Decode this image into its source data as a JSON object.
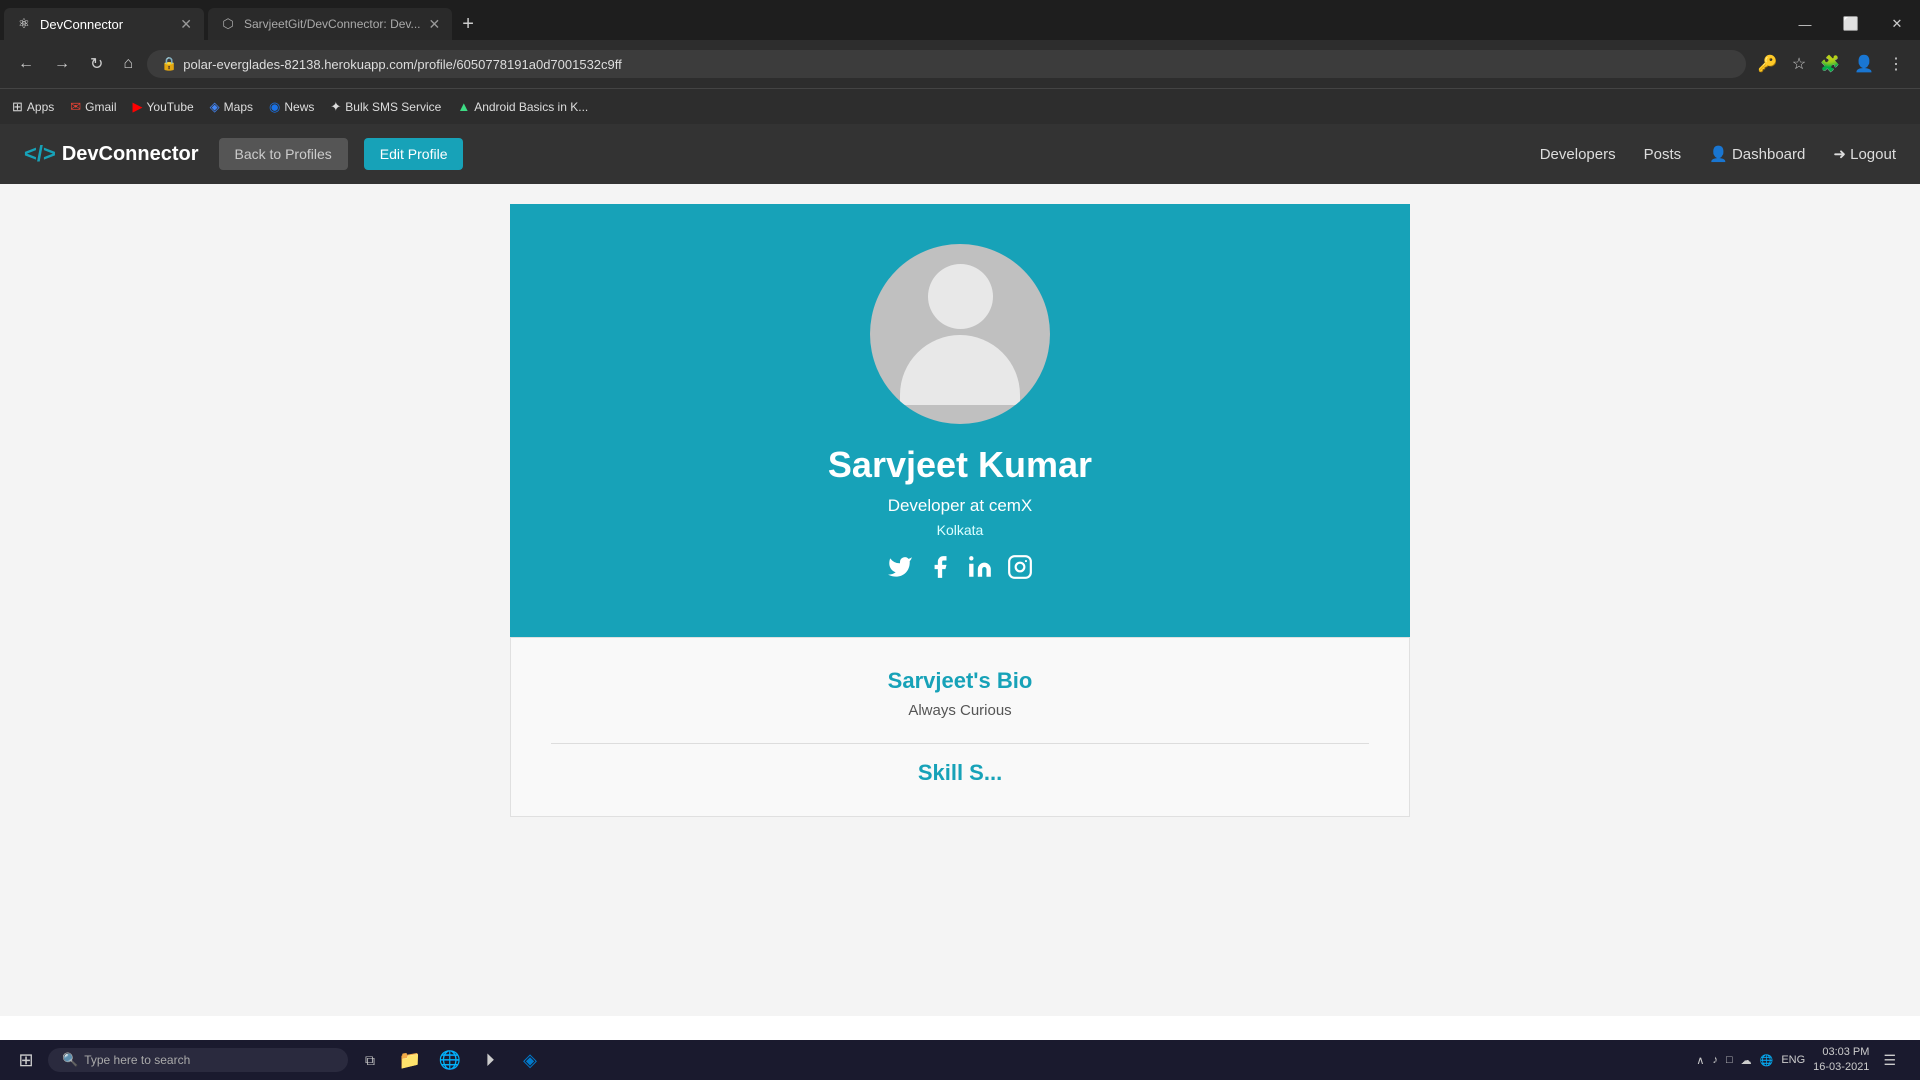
{
  "browser": {
    "tabs": [
      {
        "id": "tab1",
        "title": "DevConnector",
        "active": true,
        "favicon": "⚛"
      },
      {
        "id": "tab2",
        "title": "SarvjeetGit/DevConnector: Dev...",
        "active": false,
        "favicon": "⬡"
      }
    ],
    "url": "polar-everglades-82138.herokuapp.com/profile/6050778191a0d7001532c9ff",
    "bookmarks": [
      {
        "label": "Apps",
        "icon": "⊞"
      },
      {
        "label": "Gmail",
        "icon": "✉"
      },
      {
        "label": "YouTube",
        "icon": "▶"
      },
      {
        "label": "Maps",
        "icon": "◈"
      },
      {
        "label": "News",
        "icon": "◉"
      },
      {
        "label": "Bulk SMS Service",
        "icon": "✦"
      },
      {
        "label": "Android Basics in K...",
        "icon": "▲"
      }
    ]
  },
  "navbar": {
    "logo_code": "</>",
    "logo_name": "DevConnector",
    "back_btn": "Back to Profiles",
    "edit_btn": "Edit Profile",
    "links": [
      {
        "label": "Developers"
      },
      {
        "label": "Posts"
      },
      {
        "label": "Dashboard",
        "icon": "👤"
      },
      {
        "label": "Logout",
        "icon": "➜"
      }
    ]
  },
  "profile": {
    "name": "Sarvjeet Kumar",
    "title": "Developer at cemX",
    "location": "Kolkata",
    "bio_section_title": "Sarvjeet's Bio",
    "bio_text": "Always Curious",
    "skills_section_title": "Skill Set"
  },
  "social": {
    "twitter_icon": "🐦",
    "facebook_icon": "f",
    "linkedin_icon": "in",
    "instagram_icon": "📷"
  },
  "taskbar": {
    "start_icon": "⊞",
    "search_placeholder": "Type here to search",
    "tray_icons": [
      "∧",
      "♪",
      "□",
      "☁",
      "□",
      "WiFi",
      "ENG"
    ],
    "time": "03:03 PM",
    "date": "16-03-2021",
    "notification": "☰",
    "language": "ENG"
  }
}
